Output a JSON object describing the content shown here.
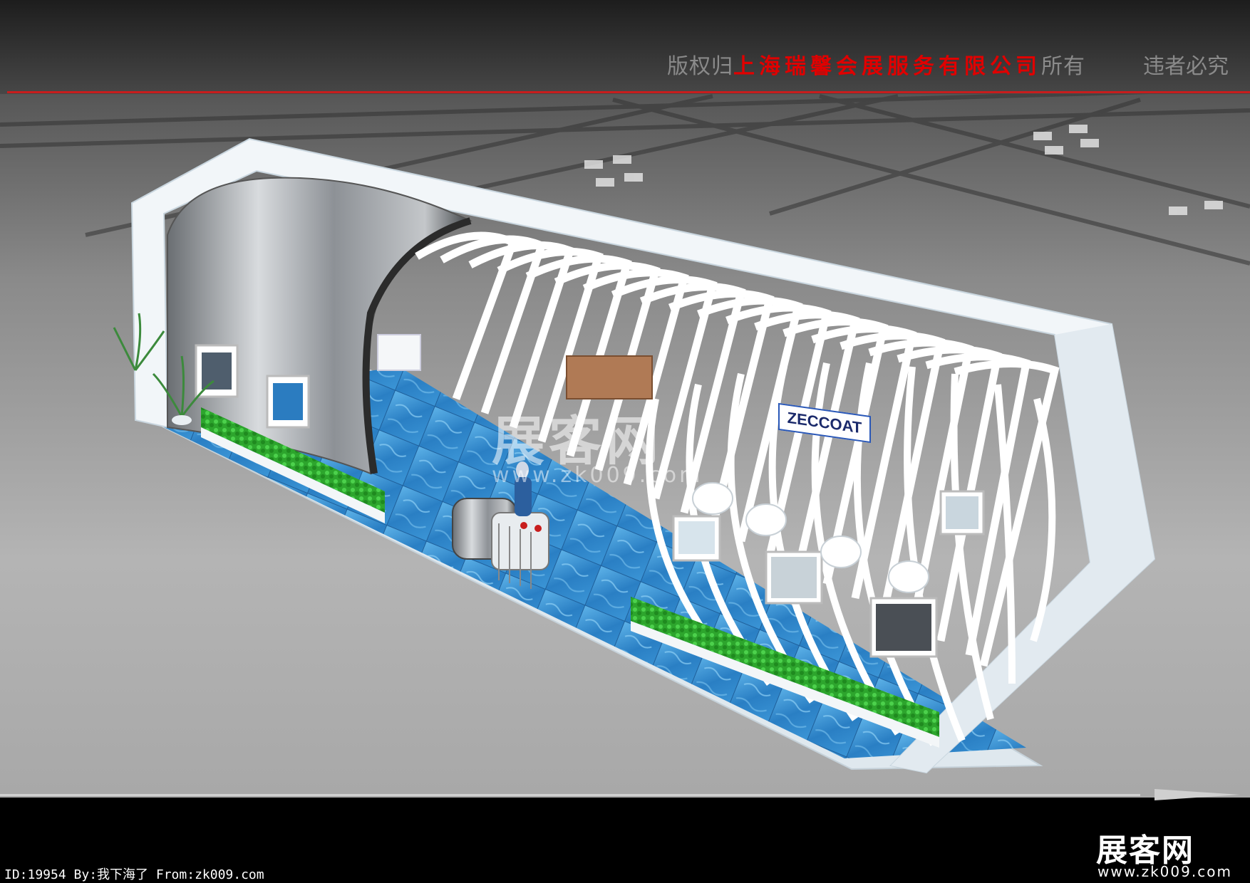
{
  "header": {
    "copyright_prefix": "版权归",
    "company": "上海瑞馨会展服务有限公司",
    "copyright_suffix": "所有",
    "warning": "违者必究"
  },
  "booth": {
    "brand_sign": "ZECCOAT"
  },
  "watermark": {
    "site_name": "展客网",
    "site_url": "www.zk009.com"
  },
  "footer": {
    "image_info": "ID:19954 By:我下海了 From:zk009.com",
    "logo_text": "展客网",
    "logo_url": "www.zk009.com"
  },
  "colors": {
    "header_bg": "#2e2e2e",
    "accent_line": "#c81d1d",
    "company_text": "#e00000",
    "floor_water": "#2f86c9",
    "arch_white": "#f4f8fb",
    "grass": "#2fb52f",
    "steel": "#9ea3a8"
  }
}
